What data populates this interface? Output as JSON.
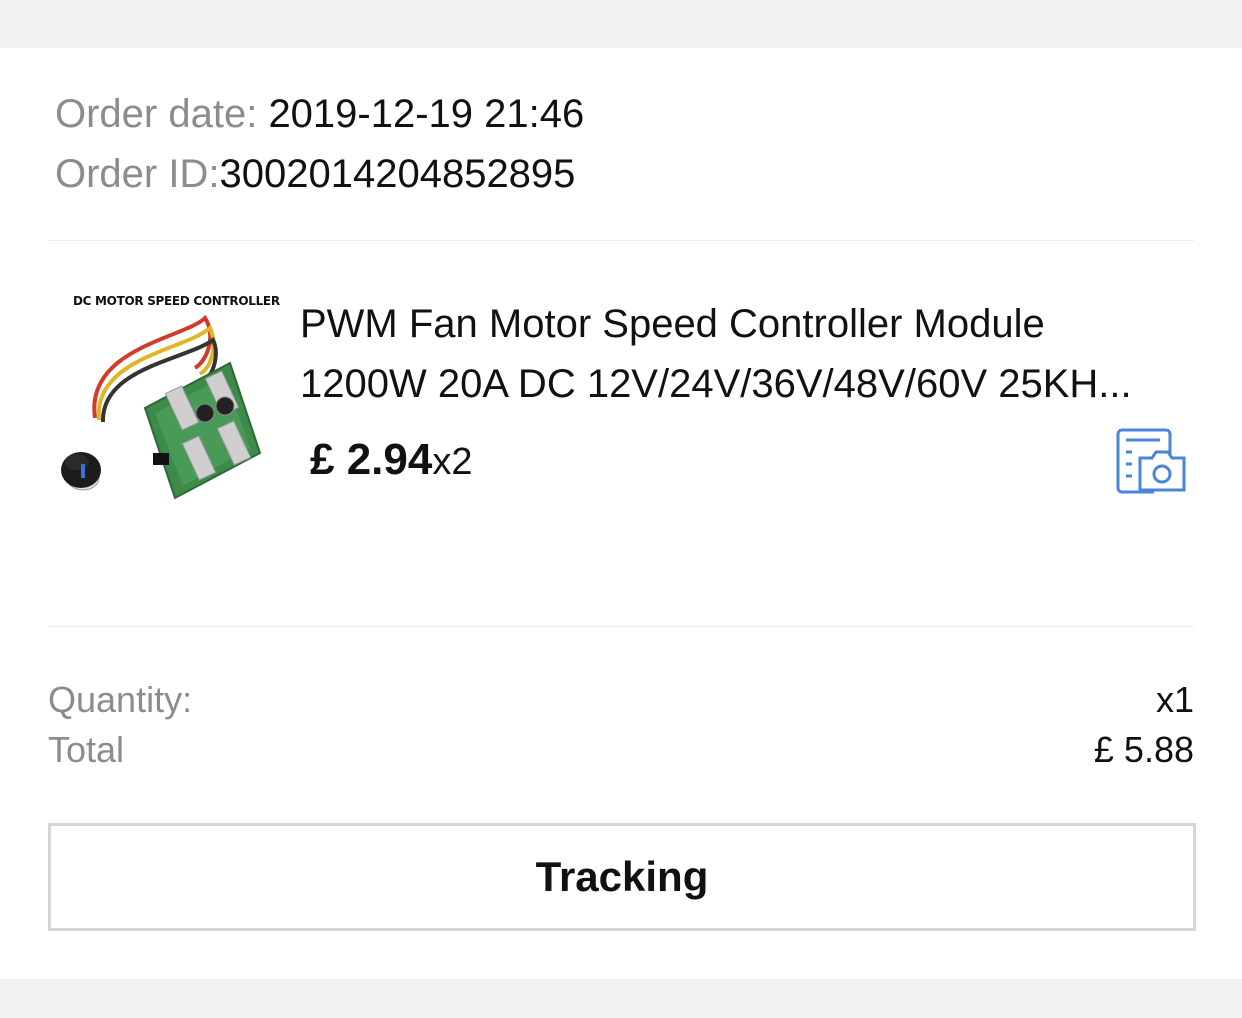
{
  "order": {
    "date_label": "Order date: ",
    "date_value": "2019-12-19 21:46",
    "id_label": "Order ID:",
    "id_value": "3002014204852895"
  },
  "product": {
    "image_caption": "DC MOTOR SPEED CONTROLLER",
    "title_line1": "PWM Fan Motor Speed Controller Module",
    "title_line2": "1200W 20A DC 12V/24V/36V/48V/60V 25KH...",
    "price": "£ 2.94",
    "quantity": "x2",
    "review_icon": "review-photo-icon"
  },
  "summary": {
    "quantity_label": "Quantity:",
    "quantity_value": "x1",
    "total_label": "Total",
    "total_value": "£ 5.88"
  },
  "actions": {
    "tracking_label": "Tracking"
  },
  "colors": {
    "background": "#f2f2f2",
    "card": "#ffffff",
    "label_gray": "#8c8c8c",
    "icon_blue": "#4a86d8"
  }
}
